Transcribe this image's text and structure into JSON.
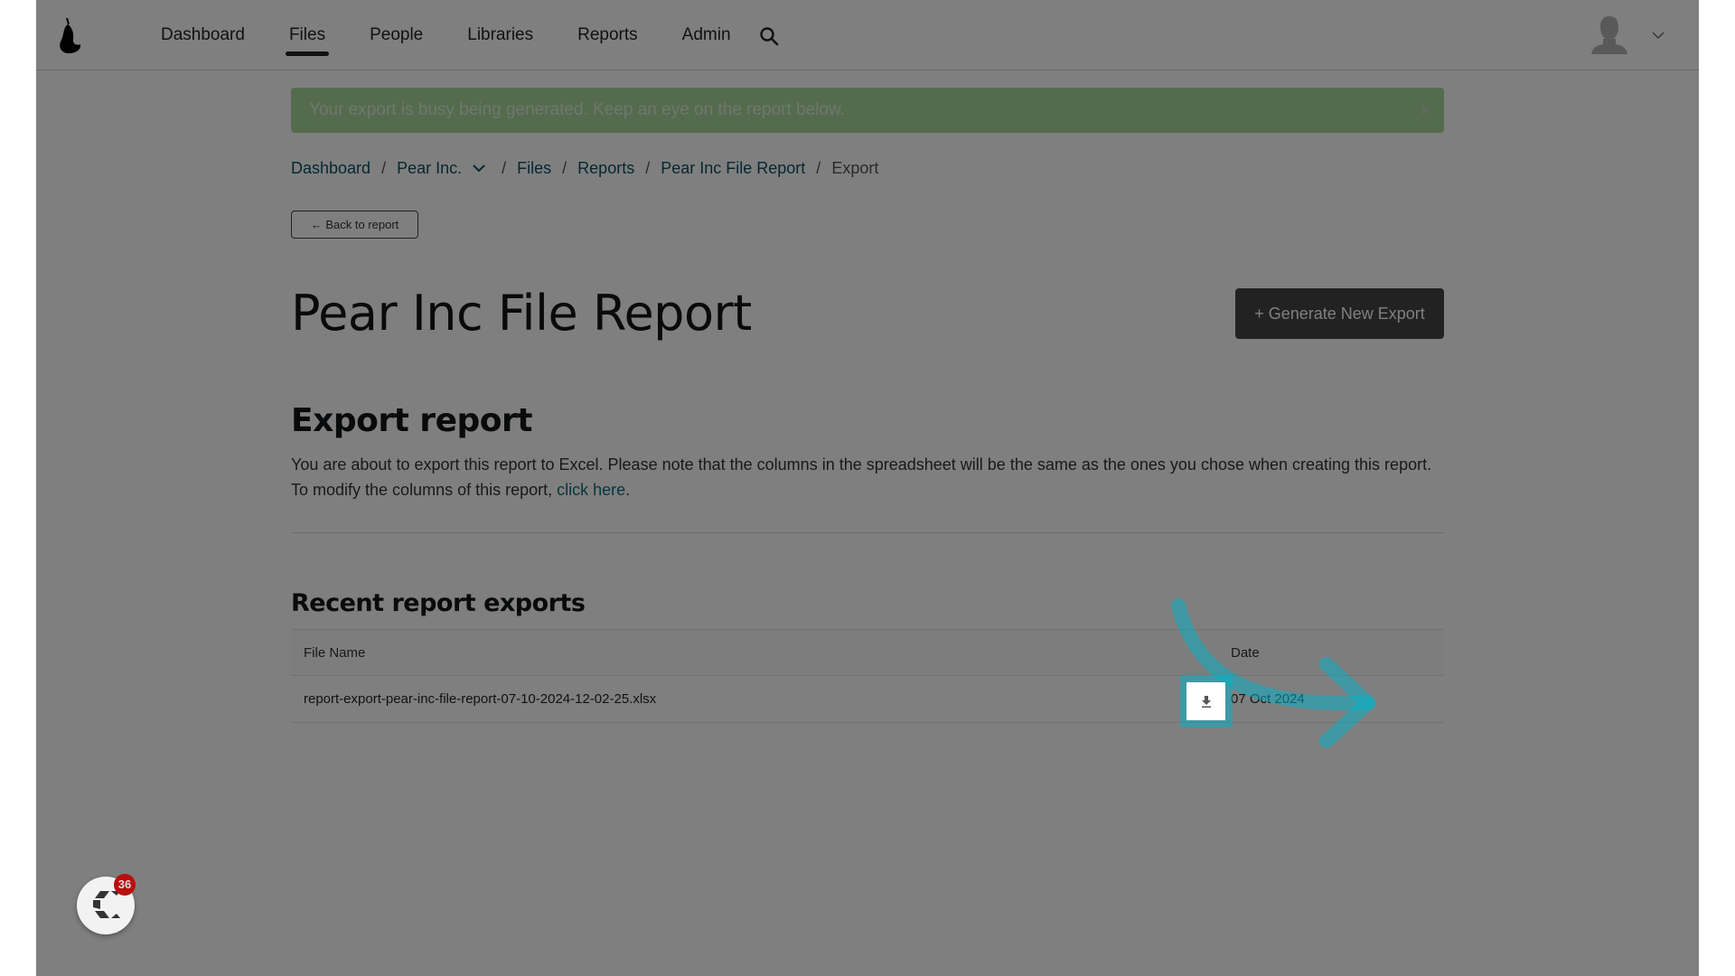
{
  "navbar": {
    "logo": "pear-logo-icon",
    "links": [
      {
        "label": "Dashboard",
        "active": false
      },
      {
        "label": "Files",
        "active": true
      },
      {
        "label": "People",
        "active": false
      },
      {
        "label": "Libraries",
        "active": false
      },
      {
        "label": "Reports",
        "active": false
      },
      {
        "label": "Admin",
        "active": false
      }
    ],
    "search_icon": "search-icon",
    "avatar_icon": "user-avatar-icon",
    "avatar_menu_icon": "chevron-down-icon"
  },
  "alert": {
    "message": "Your export is busy being generated. Keep an eye on the report below.",
    "close_label": "×",
    "color": "#a9d99b"
  },
  "breadcrumb": {
    "items": [
      "Dashboard",
      "Pear Inc.",
      "Files",
      "Reports",
      "Pear Inc File Report",
      "Export"
    ],
    "separator": "/"
  },
  "back_button": {
    "label": "← Back to report"
  },
  "page_title": "Pear Inc File Report",
  "generate_button": {
    "label": "+  Generate New Export"
  },
  "export_section": {
    "title": "Export report",
    "description_line1": "You are about to export this report to Excel. Please note that the columns in the spreadsheet will be the same as the ones you chose when creating this report.",
    "description_line2_prefix": "To modify the columns of this report, ",
    "link_label": "click here",
    "description_line2_suffix": "."
  },
  "recent_exports": {
    "title": "Recent report exports",
    "columns": [
      "File Name",
      "Date"
    ],
    "rows": [
      {
        "file_name": "report-export-pear-inc-file-report-07-10-2024-12-02-25.xlsx",
        "date": "07 Oct 2024"
      }
    ],
    "download_icon": "download-icon"
  },
  "annotation": {
    "type": "curved-arrow",
    "color": "#00b3c9",
    "target": "download-button"
  },
  "widget": {
    "badge_count": "36",
    "icon": "chat-widget-icon",
    "badge_color": "#b80f0f"
  }
}
